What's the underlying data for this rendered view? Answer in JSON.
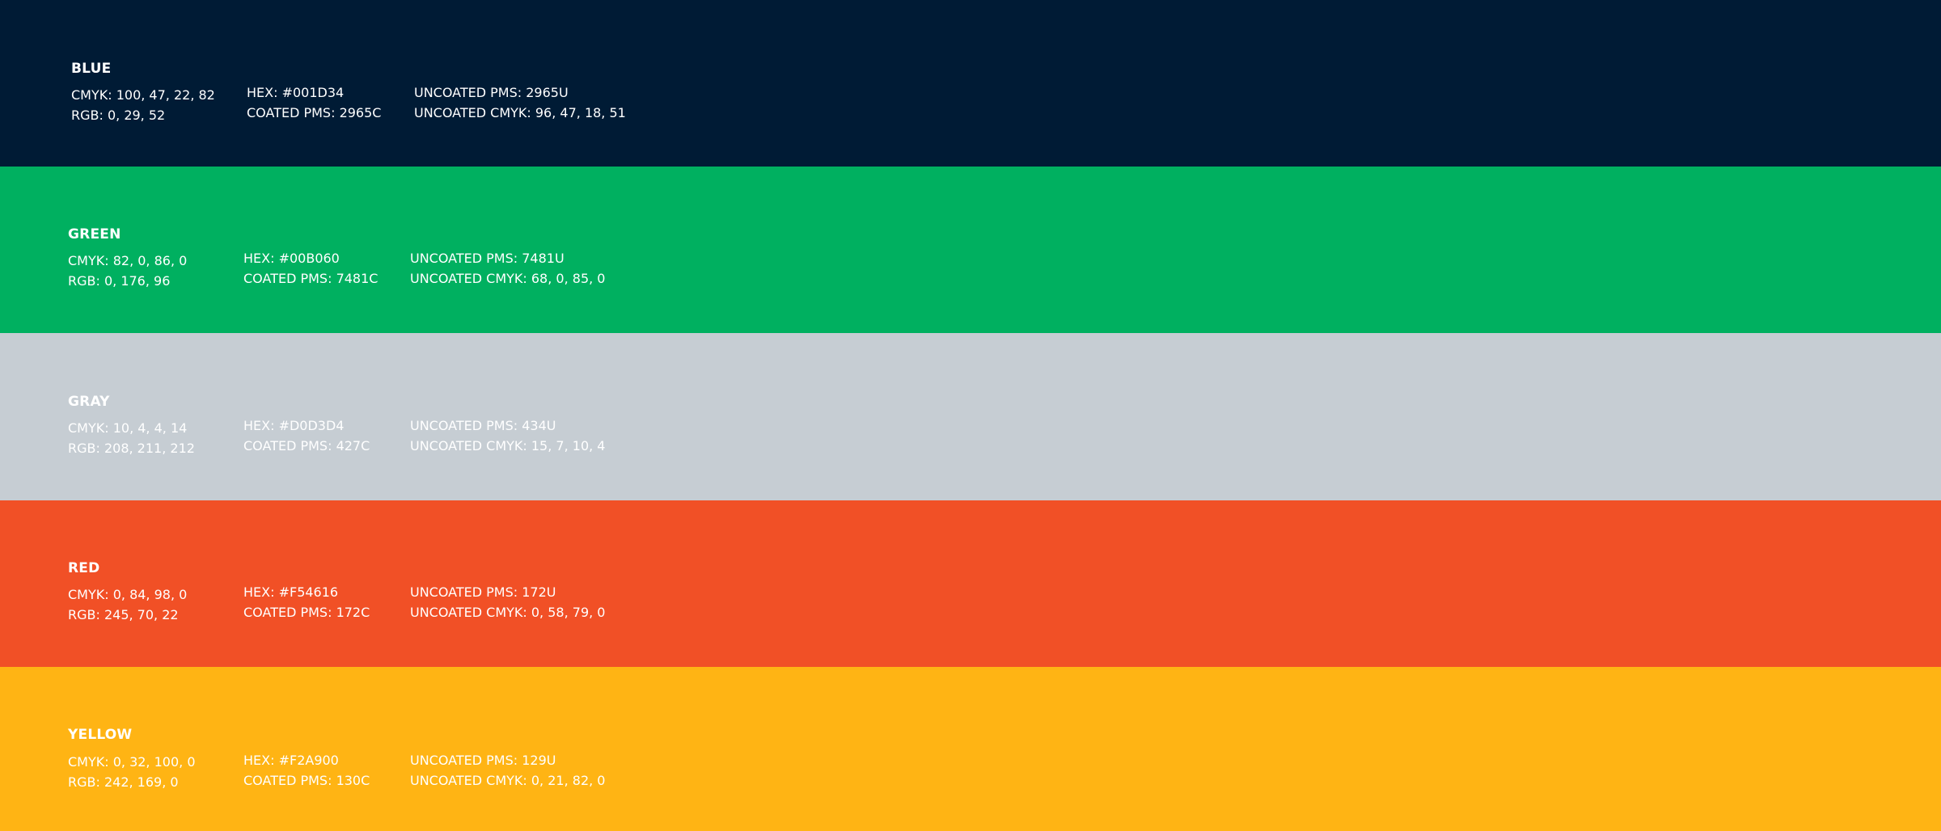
{
  "swatches": [
    {
      "name": "BLUE",
      "color": "#001B35",
      "cmyk": "CMYK: 100, 47, 22, 82",
      "rgb": "RGB: 0, 29, 52",
      "hex": "HEX: #001D34",
      "coated_pms": "COATED PMS: 2965C",
      "uncoated_pms": "UNCOATED PMS: 2965U",
      "uncoated_cmyk": "UNCOATED CMYK: 96, 47, 18, 51"
    },
    {
      "name": "GREEN",
      "color": "#00B060",
      "cmyk": "CMYK: 82, 0, 86, 0",
      "rgb": "RGB: 0, 176, 96",
      "hex": "HEX: #00B060",
      "coated_pms": "COATED PMS: 7481C",
      "uncoated_pms": "UNCOATED PMS: 7481U",
      "uncoated_cmyk": "UNCOATED CMYK: 68, 0, 85, 0"
    },
    {
      "name": "GRAY",
      "color": "#C6CDD3",
      "cmyk": "CMYK: 10, 4, 4, 14",
      "rgb": "RGB: 208, 211, 212",
      "hex": "HEX: #D0D3D4",
      "coated_pms": "COATED PMS: 427C",
      "uncoated_pms": "UNCOATED PMS: 434U",
      "uncoated_cmyk": "UNCOATED CMYK: 15, 7, 10, 4"
    },
    {
      "name": "RED",
      "color": "#F15026",
      "cmyk": "CMYK: 0, 84, 98, 0",
      "rgb": "RGB: 245, 70, 22",
      "hex": "HEX: #F54616",
      "coated_pms": "COATED PMS: 172C",
      "uncoated_pms": "UNCOATED PMS: 172U",
      "uncoated_cmyk": "UNCOATED CMYK: 0, 58, 79, 0"
    },
    {
      "name": "YELLOW",
      "color": "#FFB414",
      "cmyk": "CMYK: 0, 32, 100, 0",
      "rgb": "RGB: 242, 169, 0",
      "hex": "HEX: #F2A900",
      "coated_pms": "COATED PMS: 130C",
      "uncoated_pms": "UNCOATED PMS: 129U",
      "uncoated_cmyk": "UNCOATED CMYK: 0, 21, 82, 0"
    }
  ]
}
